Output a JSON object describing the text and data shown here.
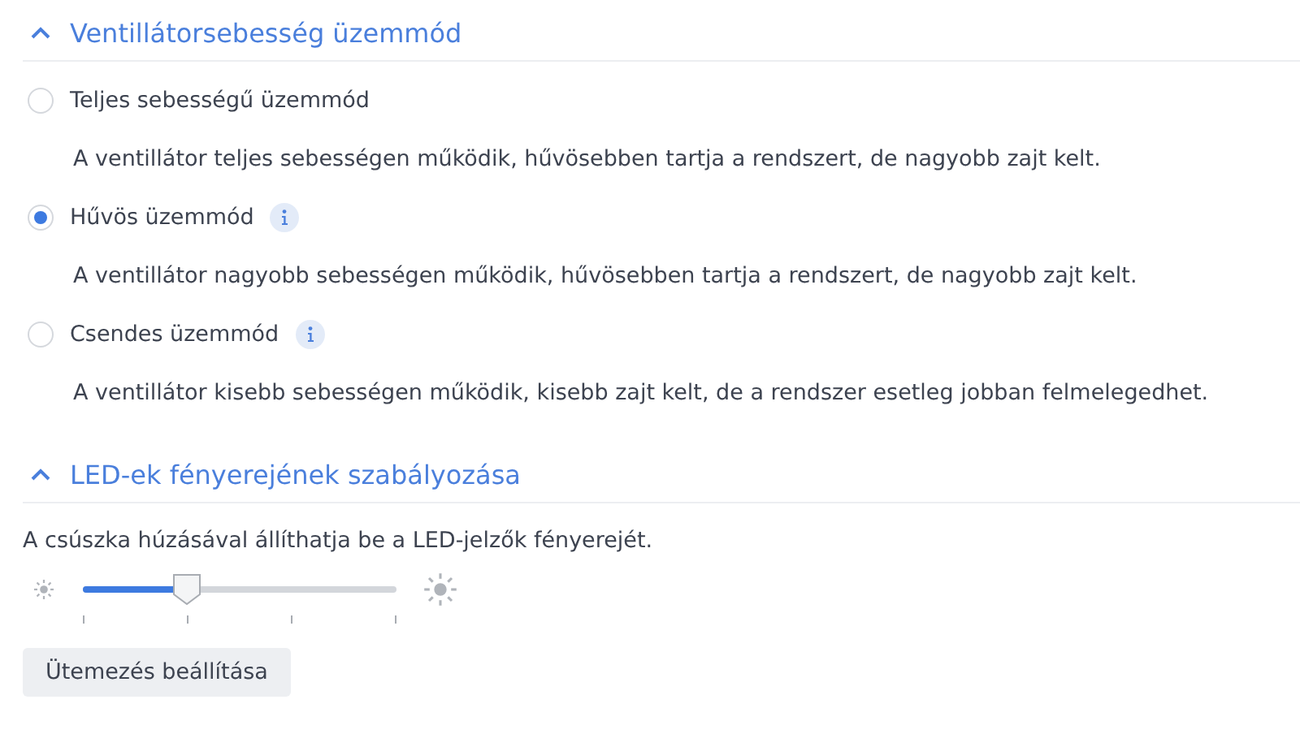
{
  "fan_section": {
    "title": "Ventillátorsebesség üzemmód",
    "expanded": true,
    "options": [
      {
        "label": "Teljes sebességű üzemmód",
        "selected": false,
        "info": false,
        "description": "A ventillátor teljes sebességen működik, hűvösebben tartja a rendszert, de nagyobb zajt kelt."
      },
      {
        "label": "Hűvös üzemmód",
        "selected": true,
        "info": true,
        "description": "A ventillátor nagyobb sebességen működik, hűvösebben tartja a rendszert, de nagyobb zajt kelt."
      },
      {
        "label": "Csendes üzemmód",
        "selected": false,
        "info": true,
        "description": "A ventillátor kisebb sebességen működik, kisebb zajt kelt, de a rendszer esetleg jobban felmelegedhet."
      }
    ]
  },
  "led_section": {
    "title": "LED-ek fényerejének szabályozása",
    "expanded": true,
    "description": "A csúszka húzásával állíthatja be a LED-jelzők fényerejét.",
    "slider": {
      "level": 0.333
    },
    "button": "Ütemezés beállítása"
  }
}
